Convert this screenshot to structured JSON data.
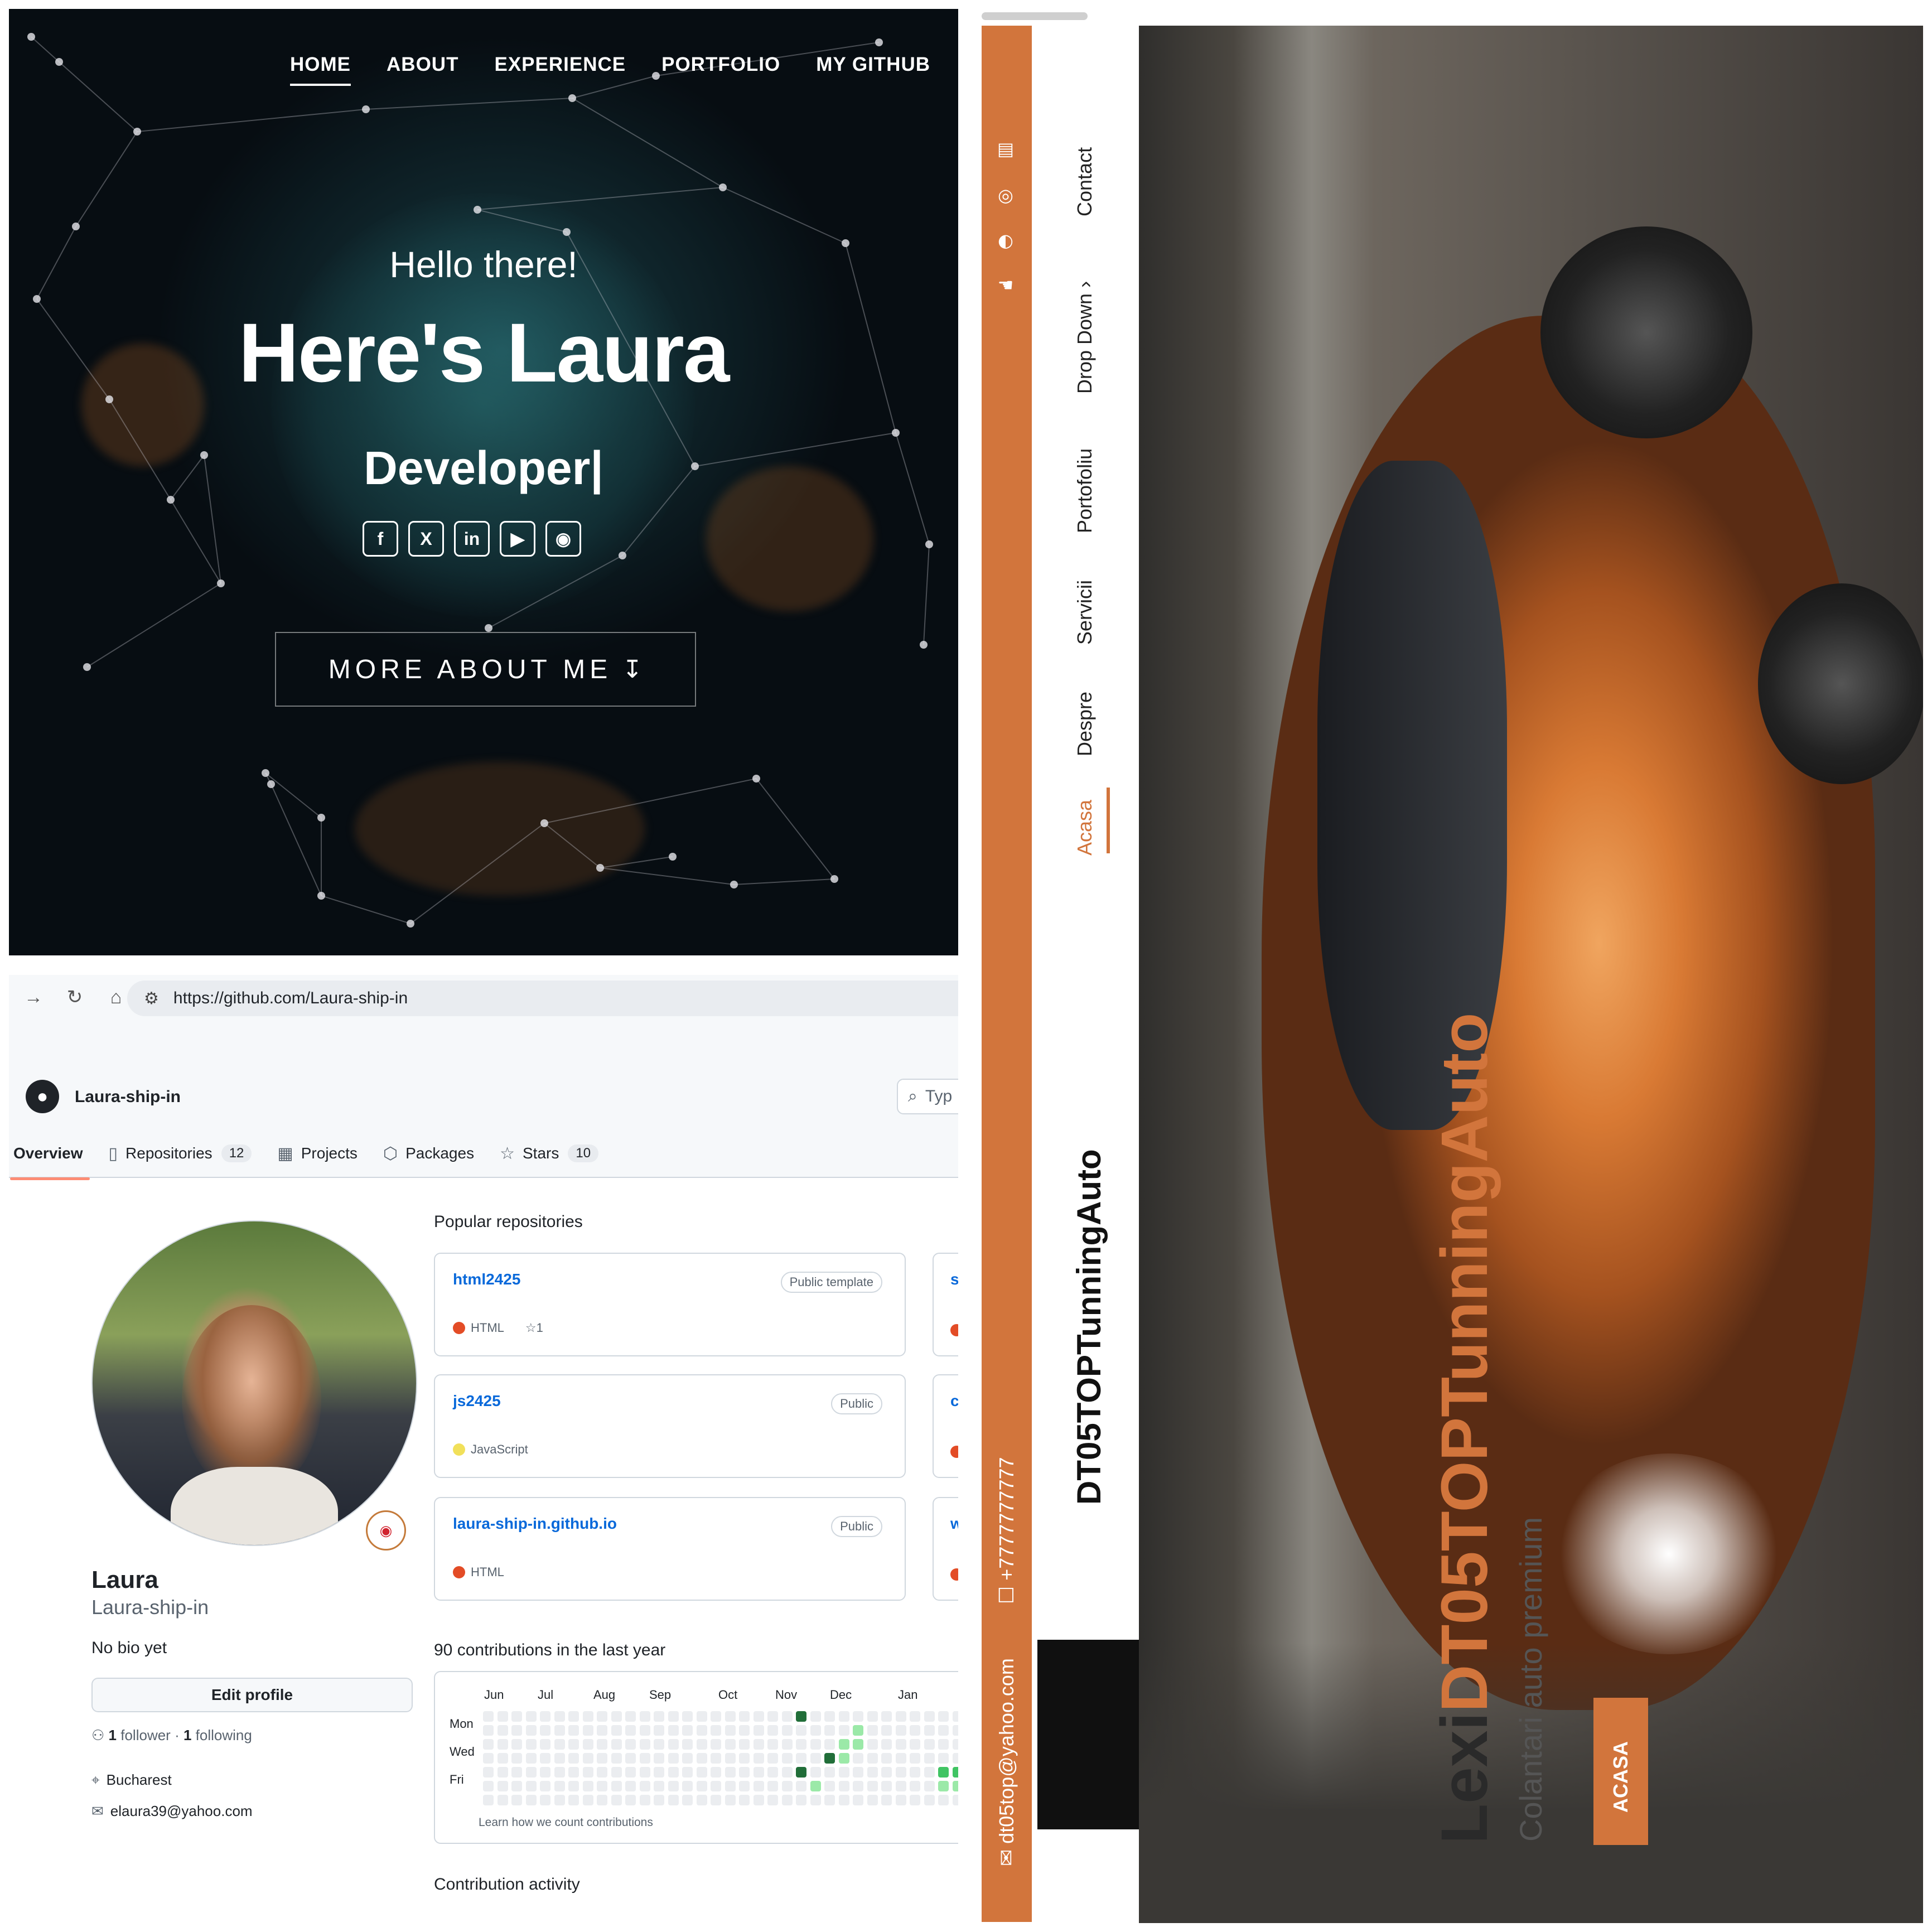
{
  "portfolio": {
    "nav": [
      "HOME",
      "ABOUT",
      "EXPERIENCE",
      "PORTFOLIO",
      "MY GITHUB"
    ],
    "greeting": "Hello there!",
    "headline": "Here's Laura",
    "role": "Developer|",
    "social": [
      {
        "icon": "facebook-icon",
        "glyph": "f"
      },
      {
        "icon": "x-icon",
        "glyph": "X"
      },
      {
        "icon": "linkedin-icon",
        "glyph": "in"
      },
      {
        "icon": "youtube-icon",
        "glyph": "▶"
      },
      {
        "icon": "github-icon",
        "glyph": "◉"
      }
    ],
    "cta": "MORE ABOUT ME",
    "cta_arrow": "↧"
  },
  "github": {
    "browser": {
      "url": "https://github.com/Laura-ship-in"
    },
    "username": "Laura-ship-in",
    "search_placeholder": "Typ",
    "tabs": [
      {
        "label": "Overview",
        "icon": "book-icon"
      },
      {
        "label": "Repositories",
        "count": "12",
        "icon": "repo-icon"
      },
      {
        "label": "Projects",
        "icon": "table-icon"
      },
      {
        "label": "Packages",
        "icon": "package-icon"
      },
      {
        "label": "Stars",
        "count": "10",
        "icon": "star-icon"
      }
    ],
    "profile": {
      "name": "Laura",
      "login": "Laura-ship-in",
      "bio": "No bio yet",
      "edit_label": "Edit profile",
      "followers": "1",
      "followers_label": "follower",
      "following": "1",
      "following_label": "following",
      "location": "Bucharest",
      "email": "elaura39@yahoo.com"
    },
    "popular_title": "Popular repositories",
    "repos": [
      {
        "name": "html2425",
        "visibility": "Public template",
        "language": "HTML",
        "lang_color": "#e34c26",
        "stars": "1"
      },
      {
        "name": "js2425",
        "visibility": "Public",
        "language": "JavaScript",
        "lang_color": "#f1e05a"
      },
      {
        "name": "laura-ship-in.github.io",
        "visibility": "Public",
        "language": "HTML",
        "lang_color": "#e34c26"
      }
    ],
    "repos_peek": [
      "ss",
      "cs",
      "w"
    ],
    "contributions_title": "90 contributions in the last year",
    "months": [
      "Jun",
      "Jul",
      "Aug",
      "Sep",
      "Oct",
      "Nov",
      "Dec",
      "Jan"
    ],
    "days": [
      "Mon",
      "Wed",
      "Fri"
    ],
    "learn_link": "Learn how we count contributions",
    "activity_title": "Contribution activity",
    "colors": {
      "link": "#0969da",
      "tab_underline": "#fd8c73",
      "green_dark": "#216e39",
      "green_mid": "#40c463",
      "green_light": "#9be9a8",
      "empty": "#ebedf0"
    }
  },
  "tuning": {
    "accent": "#d2753c",
    "contact": [
      "dt05top@yahoo.com",
      "+7777777777"
    ],
    "social_icons": [
      "blogger-icon",
      "instagram-icon",
      "pinterest-icon",
      "hand-icon"
    ],
    "menu": [
      "Acasa",
      "Despre",
      "Servicii",
      "Portofoliu",
      "Drop Down",
      "Contact"
    ],
    "brand": "DT05TOPTunningAuto",
    "hero_prefix": "Lexi",
    "hero_brand": "DT05TOPTunningAuto",
    "tagline": "Colantari auto premium",
    "button": "ACASA"
  }
}
